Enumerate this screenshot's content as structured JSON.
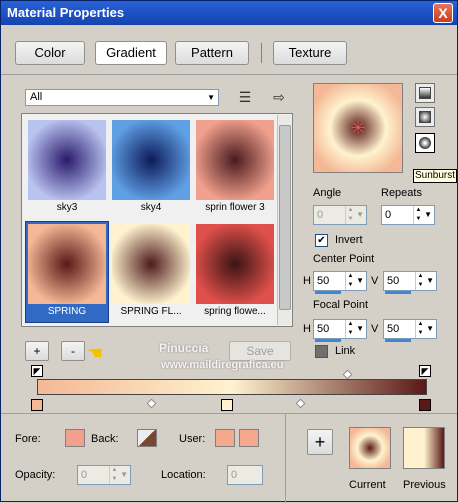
{
  "window": {
    "title": "Material Properties",
    "close_label": "X"
  },
  "tabs": [
    {
      "label": "Color"
    },
    {
      "label": "Gradient"
    },
    {
      "label": "Pattern"
    },
    {
      "label": "Texture"
    }
  ],
  "filter": {
    "selected": "All"
  },
  "gallery": {
    "items": [
      {
        "label": "sky3",
        "inner": "#2a1a6c",
        "outer": "#b9c3f0"
      },
      {
        "label": "sky4",
        "inner": "#0d1a5a",
        "outer": "#5fa0e4"
      },
      {
        "label": "sprin flower 3",
        "inner": "#4a1a1e",
        "outer": "#f0a08c"
      },
      {
        "label": "SPRING",
        "inner": "#5a1816",
        "outer": "#f4b896"
      },
      {
        "label": "SPRING FL...",
        "inner": "#4e1a1a",
        "outer": "#fff3cf"
      },
      {
        "label": "spring flowe...",
        "inner": "#3a1414",
        "outer": "#e0504a"
      }
    ]
  },
  "gallery_buttons": {
    "add": "+",
    "remove": "-",
    "save": "Save"
  },
  "settings": {
    "angle_label": "Angle",
    "angle_value": "0",
    "repeats_label": "Repeats",
    "repeats_value": "0",
    "invert_label": "Invert",
    "invert_checked": true,
    "center_label": "Center Point",
    "center_h": "50",
    "center_v": "50",
    "h_label": "H",
    "v_label": "V",
    "focal_label": "Focal Point",
    "focal_h": "50",
    "focal_v": "50",
    "link_label": "Link",
    "link_checked": false
  },
  "style_tooltip": "Sunburst",
  "gradient_stops": [
    "#f4b896",
    "#fff3cf",
    "#5a1816"
  ],
  "bottom": {
    "fore_label": "Fore:",
    "back_label": "Back:",
    "user_label": "User:",
    "opacity_label": "Opacity:",
    "opacity_value": "0",
    "location_label": "Location:",
    "location_value": "0",
    "add_label": "+",
    "current_label": "Current",
    "previous_label": "Previous"
  },
  "watermark": {
    "name": "Pinuccia",
    "url": "www.maildiregrafica.eu"
  }
}
